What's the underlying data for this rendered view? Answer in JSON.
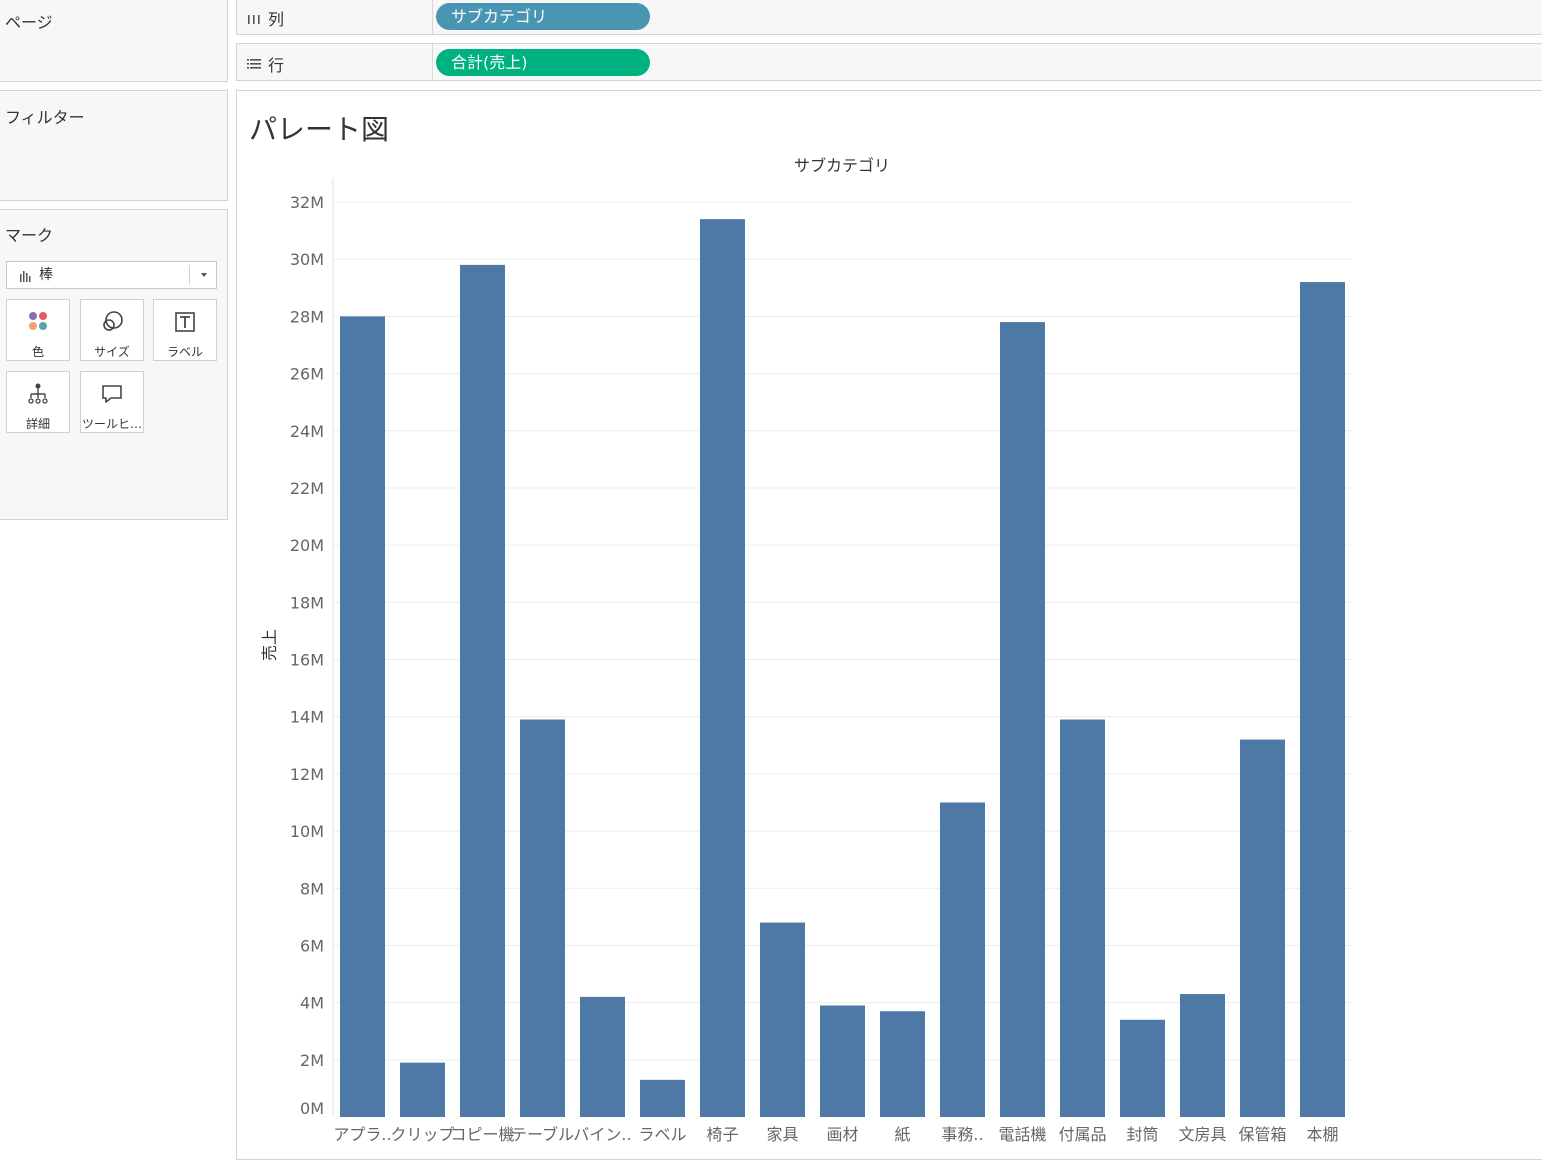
{
  "side_panels": {
    "pages": {
      "title": "ページ"
    },
    "filters": {
      "title": "フィルター"
    },
    "marks": {
      "title": "マーク",
      "mark_type": "棒",
      "buttons": [
        {
          "label": "色",
          "icon": "color-icon"
        },
        {
          "label": "サイズ",
          "icon": "size-icon"
        },
        {
          "label": "ラベル",
          "icon": "label-icon"
        },
        {
          "label": "詳細",
          "icon": "detail-icon"
        },
        {
          "label": "ツールヒ…",
          "icon": "tooltip-icon"
        }
      ]
    }
  },
  "shelves": {
    "columns": {
      "label": "列",
      "pill": "サブカテゴリ",
      "pill_color": "#4996b2",
      "icon": "columns-icon"
    },
    "rows": {
      "label": "行",
      "pill": "合計(売上)",
      "pill_color": "#00b180",
      "icon": "rows-icon"
    }
  },
  "sheet": {
    "title": "パレート図"
  },
  "colors": {
    "bar": "#4e79a7",
    "grid": "#ececec",
    "axis_text": "#666666"
  },
  "chart_data": {
    "type": "bar",
    "title": "",
    "header": "サブカテゴリ",
    "xlabel": "",
    "ylabel": "売上",
    "ylim": [
      0,
      32000000
    ],
    "yticks": [
      0,
      2000000,
      4000000,
      6000000,
      8000000,
      10000000,
      12000000,
      14000000,
      16000000,
      18000000,
      20000000,
      22000000,
      24000000,
      26000000,
      28000000,
      30000000,
      32000000
    ],
    "ytick_labels": [
      "0M",
      "2M",
      "4M",
      "6M",
      "8M",
      "10M",
      "12M",
      "14M",
      "16M",
      "18M",
      "20M",
      "22M",
      "24M",
      "26M",
      "28M",
      "30M",
      "32M"
    ],
    "grid": true,
    "categories": [
      "アプラ..",
      "クリップ",
      "コピー機",
      "テーブル",
      "バイン..",
      "ラベル",
      "椅子",
      "家具",
      "画材",
      "紙",
      "事務..",
      "電話機",
      "付属品",
      "封筒",
      "文房具",
      "保管箱",
      "本棚"
    ],
    "values": [
      28000000,
      1900000,
      29800000,
      13900000,
      4200000,
      1300000,
      31400000,
      6800000,
      3900000,
      3700000,
      11000000,
      27800000,
      13900000,
      3400000,
      4300000,
      13200000,
      29200000
    ]
  }
}
